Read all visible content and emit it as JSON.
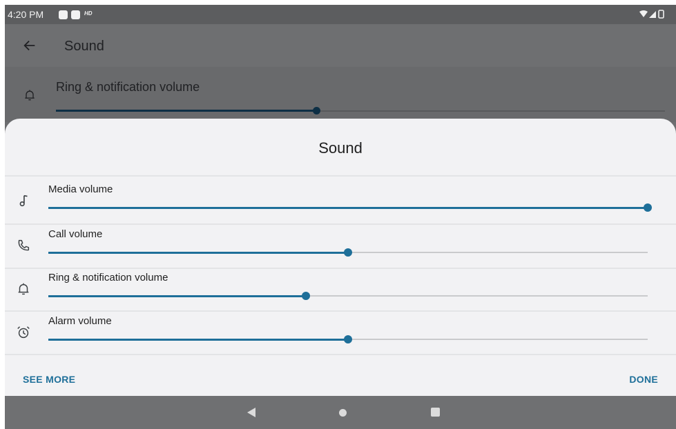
{
  "status_bar": {
    "time": "4:20 PM",
    "hd_badge": "HD",
    "icons": [
      "wifi-icon",
      "cell-signal-icon",
      "battery-icon"
    ]
  },
  "background_page": {
    "title": "Sound",
    "back_icon": "back-arrow-icon",
    "row": {
      "label": "Ring & notification volume",
      "icon": "bell-icon",
      "level": 0.44
    }
  },
  "sheet": {
    "title": "Sound",
    "accent_color": "#1e6f99",
    "sliders": [
      {
        "label": "Media volume",
        "icon": "music-note-icon",
        "level": 1.0
      },
      {
        "label": "Call volume",
        "icon": "phone-icon",
        "level": 0.5
      },
      {
        "label": "Ring & notification volume",
        "icon": "bell-icon",
        "level": 0.43
      },
      {
        "label": "Alarm volume",
        "icon": "alarm-clock-icon",
        "level": 0.5
      }
    ],
    "see_more_label": "SEE MORE",
    "done_label": "DONE"
  },
  "nav_bar": {
    "icons": [
      "nav-back-icon",
      "nav-home-icon",
      "nav-recents-icon"
    ]
  }
}
